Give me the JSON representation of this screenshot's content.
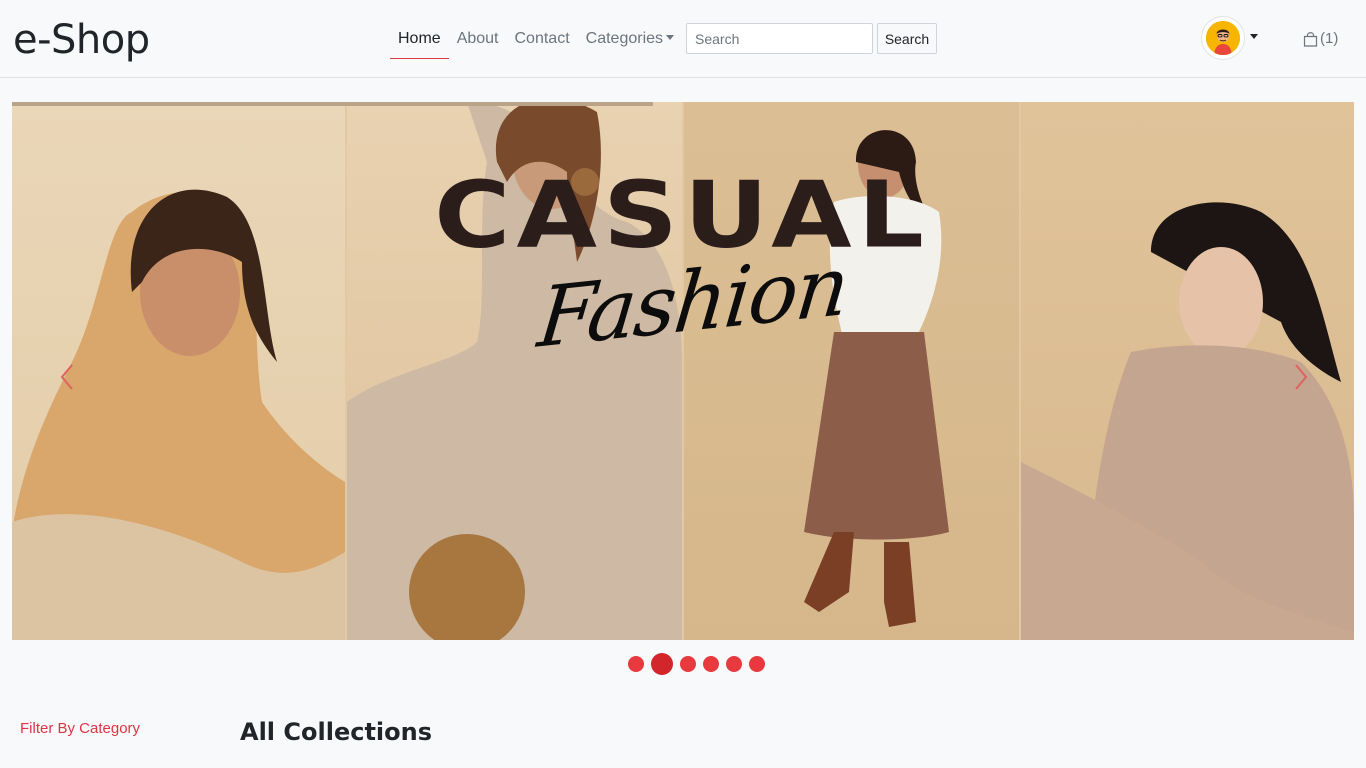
{
  "brand": "e-Shop",
  "nav": {
    "home": "Home",
    "about": "About",
    "contact": "Contact",
    "categories": "Categories"
  },
  "search": {
    "placeholder": "Search",
    "button": "Search"
  },
  "cart": {
    "count_label": "(1)"
  },
  "carousel": {
    "headline": "CASUAL",
    "script": "Fashion",
    "slide_count": 6,
    "active_slide": 2
  },
  "sidebar": {
    "filter_title": "Filter By Category"
  },
  "main": {
    "section_title": "All Collections"
  },
  "colors": {
    "accent": "#dc3545",
    "indicator": "#e8393f"
  }
}
